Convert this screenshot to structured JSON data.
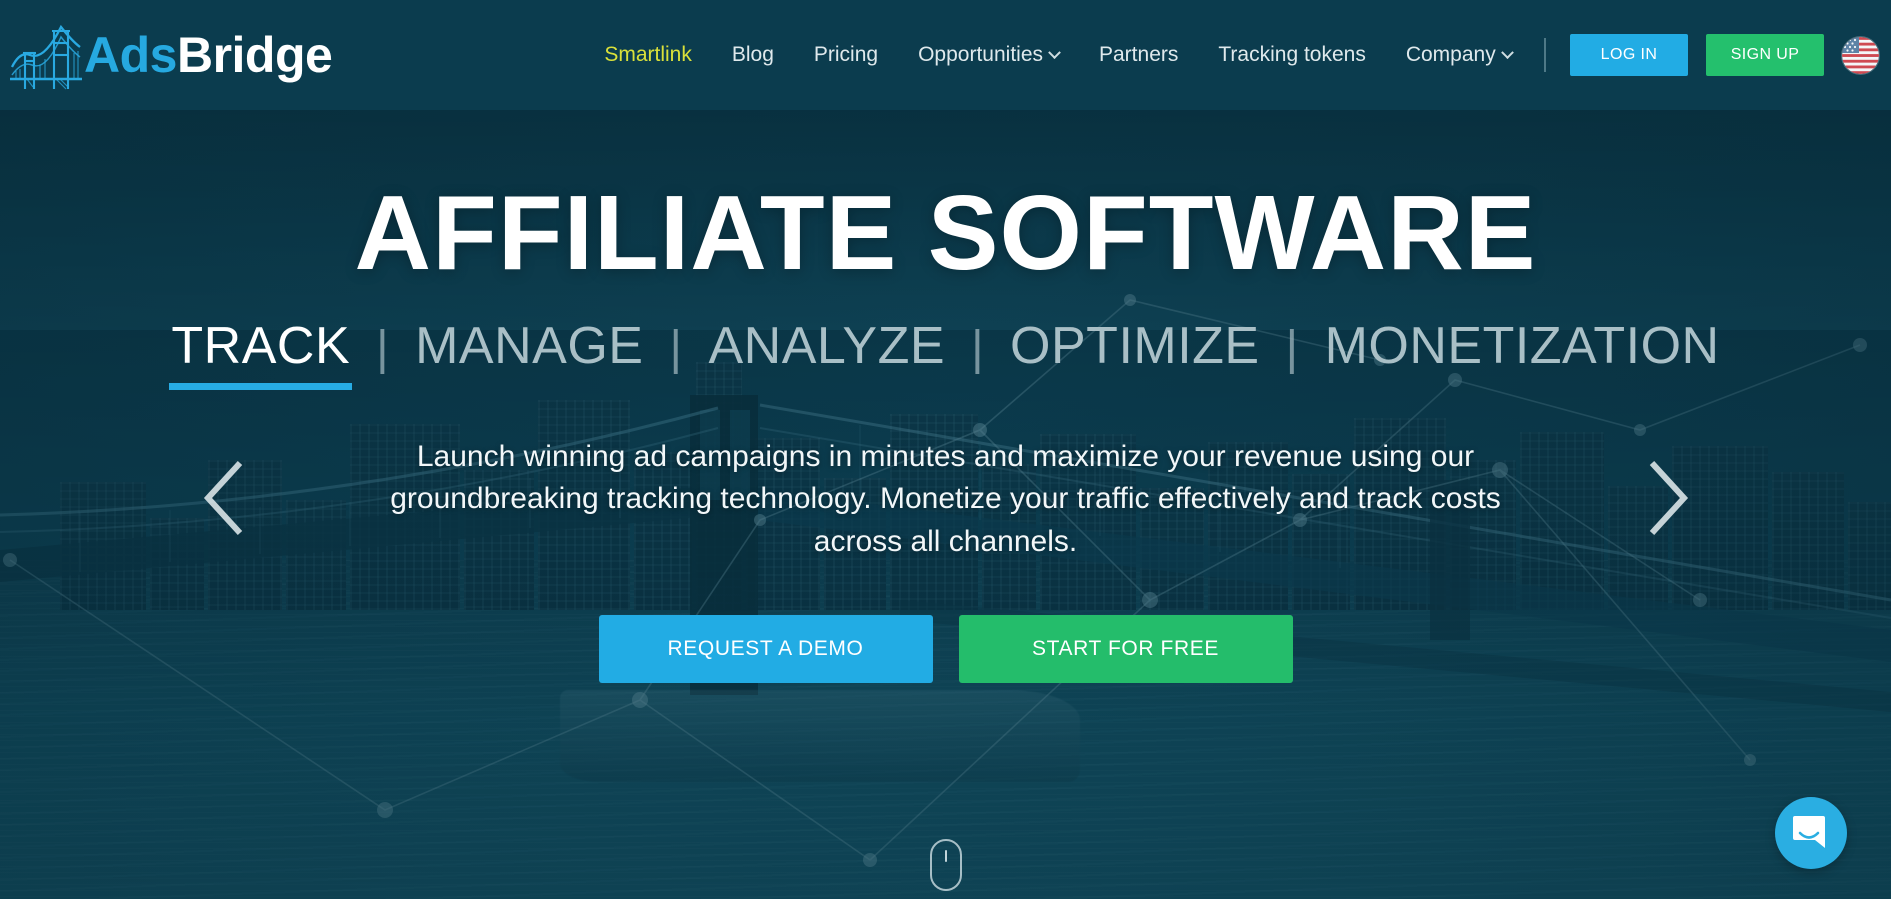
{
  "header": {
    "logo": {
      "icon": "bridge-logo-icon",
      "text_primary": "Ads",
      "text_secondary": "Bridge"
    },
    "nav": [
      {
        "label": "Smartlink",
        "active": true,
        "has_dropdown": false
      },
      {
        "label": "Blog",
        "active": false,
        "has_dropdown": false
      },
      {
        "label": "Pricing",
        "active": false,
        "has_dropdown": false
      },
      {
        "label": "Opportunities",
        "active": false,
        "has_dropdown": true
      },
      {
        "label": "Partners",
        "active": false,
        "has_dropdown": false
      },
      {
        "label": "Tracking tokens",
        "active": false,
        "has_dropdown": false
      },
      {
        "label": "Company",
        "active": false,
        "has_dropdown": true
      }
    ],
    "login_label": "LOG IN",
    "signup_label": "SIGN UP",
    "language_flag": "us-flag-icon",
    "colors": {
      "background": "#0b3c4e",
      "active_nav": "#d9e03a",
      "login": "#22ace4",
      "signup": "#24c06d"
    }
  },
  "hero": {
    "title": "AFFILIATE SOFTWARE",
    "words": [
      {
        "label": "TRACK",
        "active": true
      },
      {
        "label": "MANAGE",
        "active": false
      },
      {
        "label": "ANALYZE",
        "active": false
      },
      {
        "label": "OPTIMIZE",
        "active": false
      },
      {
        "label": "MONETIZATION",
        "active": false
      }
    ],
    "separator": "|",
    "description": "Launch winning ad campaigns in minutes and maximize your revenue using our groundbreaking tracking technology. Monetize your traffic effectively and track costs across all channels.",
    "cta_primary": "REQUEST A DEMO",
    "cta_secondary": "START FOR FREE",
    "prev_arrow": "chevron-left-icon",
    "next_arrow": "chevron-right-icon",
    "scroll_indicator": "mouse-scroll-icon",
    "underline_color": "#27ace4"
  },
  "widgets": {
    "chat": "chat-bubble-icon",
    "chat_color": "#2aaee2"
  }
}
